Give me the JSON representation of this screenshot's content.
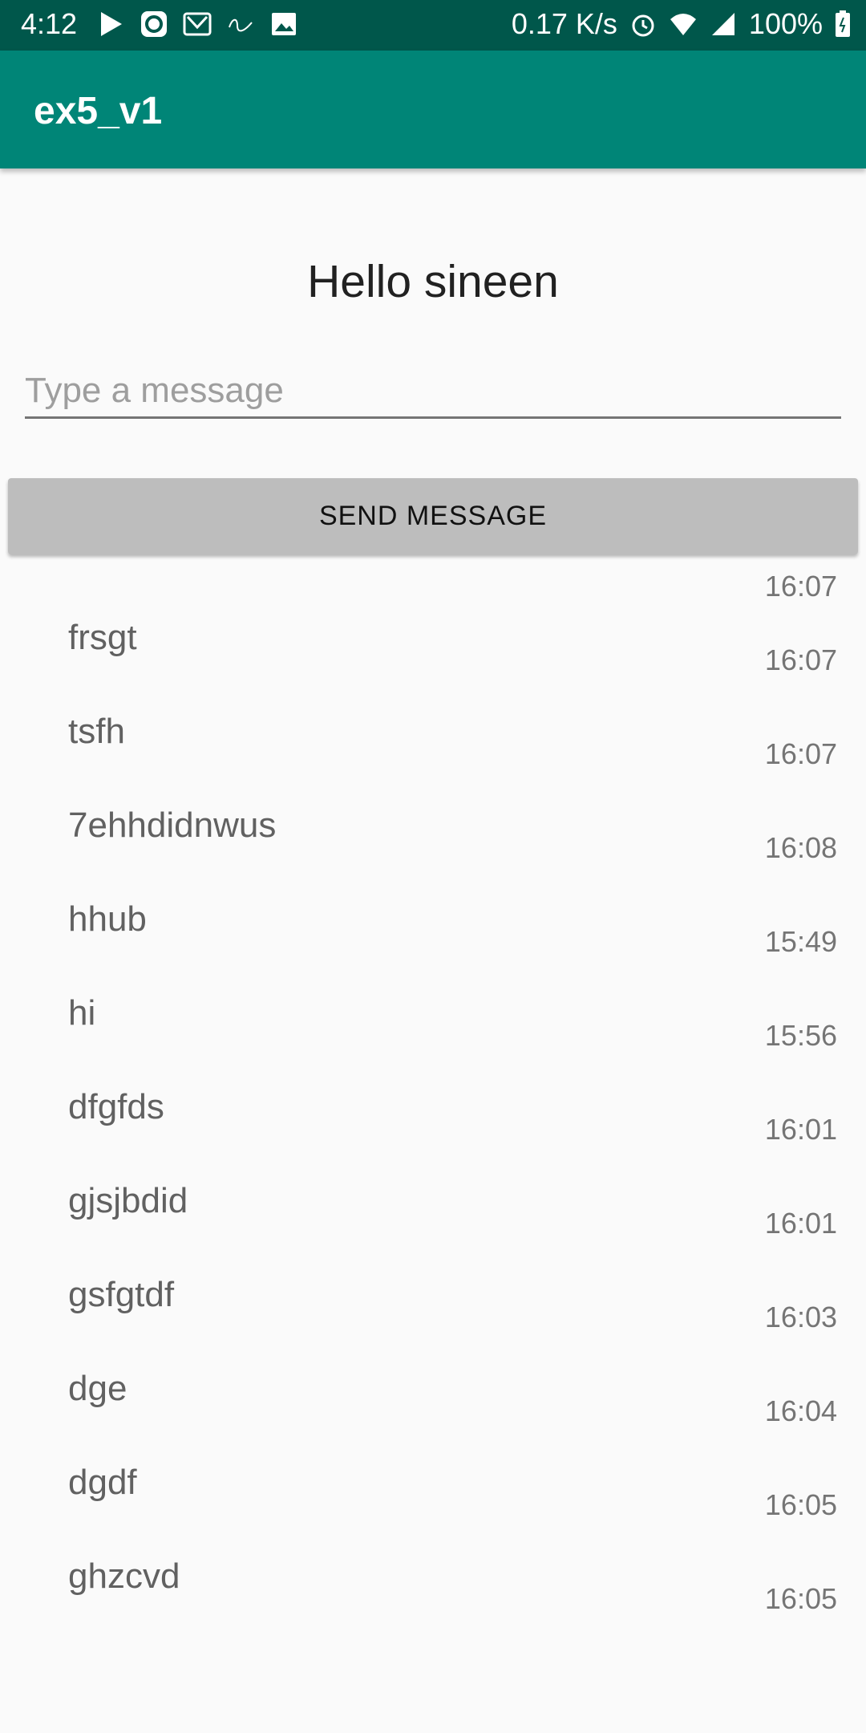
{
  "status_bar": {
    "time": "4:12",
    "network_speed": "0.17 K/s",
    "battery": "100%",
    "left_icons": [
      "play-icon",
      "sync-icon",
      "mail-icon",
      "calm-icon",
      "image-icon"
    ],
    "right_icons": [
      "alarm-icon",
      "wifi-icon",
      "signal-icon",
      "battery-icon"
    ]
  },
  "app_bar": {
    "title": "ex5_v1"
  },
  "main": {
    "greeting": "Hello sineen",
    "input_placeholder": "Type a message",
    "input_value": "",
    "send_label": "SEND MESSAGE"
  },
  "messages": [
    {
      "text": "",
      "time": "16:07"
    },
    {
      "text": "frsgt",
      "time": "16:07"
    },
    {
      "text": "tsfh",
      "time": "16:07"
    },
    {
      "text": "7ehhdidnwus",
      "time": "16:08"
    },
    {
      "text": "hhub",
      "time": "15:49"
    },
    {
      "text": "hi",
      "time": "15:56"
    },
    {
      "text": "dfgfds",
      "time": "16:01"
    },
    {
      "text": "gjsjbdid",
      "time": "16:01"
    },
    {
      "text": "gsfgtdf",
      "time": "16:03"
    },
    {
      "text": "dge",
      "time": "16:04"
    },
    {
      "text": "dgdf",
      "time": "16:05"
    },
    {
      "text": "ghzcvd",
      "time": "16:05"
    }
  ],
  "colors": {
    "status_bar": "#00574b",
    "app_bar": "#008577",
    "background": "#fafafa",
    "button": "#bdbdbd"
  }
}
